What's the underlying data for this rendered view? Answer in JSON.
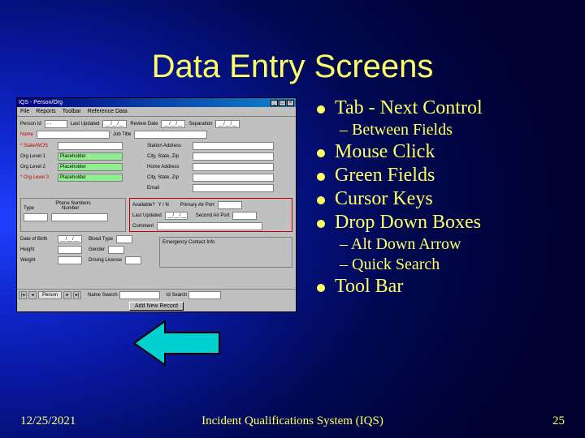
{
  "title": "Data Entry Screens",
  "app": {
    "titlebar": "IQS - Person/Org",
    "menus": [
      "File",
      "Reports",
      "Toolbar",
      "Reference Data"
    ],
    "row1": {
      "person_id_lbl": "Person Id",
      "last_updated_lbl": "Last Updated",
      "last_updated_val": "__/__/__",
      "review_date_lbl": "Review Date",
      "review_date_val": "__/__/__",
      "sep_lbl": "Separation",
      "sep_date_val": "__/__/__"
    },
    "row2": {
      "name_lbl": "Name",
      "job_title_lbl": "Job Title"
    },
    "left_block": {
      "state_lbl": "* State/WOS",
      "org1_lbl": "Org Level 1",
      "org2_lbl": "Org Level 2",
      "org3_lbl": "* Org Level 3",
      "placeholder": "Placeholder"
    },
    "right_block": {
      "station_lbl": "Station Address",
      "csz_lbl": "City, State, Zip",
      "home_lbl": "Home Address",
      "csz2_lbl": "City, State, Zip",
      "email_lbl": "Email"
    },
    "phone_group": {
      "title": "Phone Numbers",
      "type_lbl": "Type",
      "number_lbl": "Number"
    },
    "red_group": {
      "avail_lbl": "Available?",
      "avail_val": "Y / N",
      "last_upd_lbl": "Last Updated",
      "last_upd_val": "__/__/__",
      "comment_lbl": "Comment",
      "primary_lbl": "Primary Air Port",
      "second_lbl": "Second Air Port"
    },
    "lower_left": {
      "dob_lbl": "Date of Birth",
      "dob_val": "__/__/__",
      "height_lbl": "Height",
      "weight_lbl": "Weight",
      "blood_lbl": "Blood Type",
      "gender_lbl": "Gender",
      "dl_lbl": "Driving License"
    },
    "lower_right": {
      "emergency_lbl": "Emergency Contact Info"
    },
    "tabs": {
      "t1": "Person",
      "name_search": "Name Search",
      "id_search": "Id Search"
    },
    "bottom_button": "Add New Record"
  },
  "bullets": {
    "b1": "Tab - Next Control",
    "s1": "Between Fields",
    "b2": "Mouse Click",
    "b3": "Green Fields",
    "b4": "Cursor Keys",
    "b5": "Drop Down Boxes",
    "s2": "Alt Down Arrow",
    "s3": "Quick Search",
    "b6": "Tool Bar"
  },
  "footer": {
    "date": "12/25/2021",
    "center": "Incident Qualifications System (IQS)",
    "page": "25"
  }
}
